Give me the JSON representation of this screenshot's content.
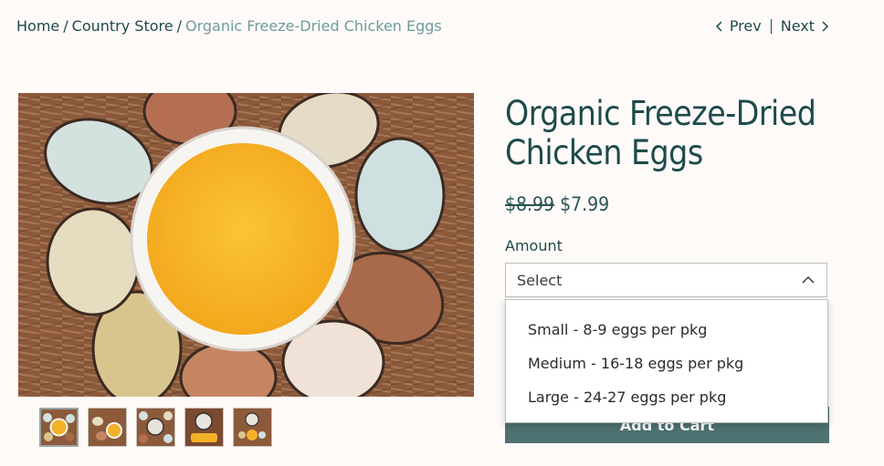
{
  "breadcrumb": {
    "items": [
      "Home",
      "Country Store"
    ],
    "current": "Organic Freeze-Dried Chicken Eggs",
    "separator": "/"
  },
  "pager": {
    "prev": "Prev",
    "next": "Next"
  },
  "product": {
    "title": "Organic Freeze-Dried Chicken Eggs",
    "old_price": "$8.99",
    "price": "$7.99",
    "amount_label": "Amount",
    "select_value": "Select",
    "options": [
      "Small - 8-9 eggs per pkg",
      "Medium - 16-18 eggs per pkg",
      "Large - 24-27 eggs per pkg"
    ],
    "add_to_cart": "Add to Cart"
  },
  "colors": {
    "brand_teal": "#1e4a4a",
    "muted_teal": "#6e9c9c",
    "button": "#4f7272",
    "background": "#fdfaf8"
  },
  "icons": {
    "prev": "chevron-left-icon",
    "next": "chevron-right-icon",
    "select": "chevron-up-icon"
  }
}
